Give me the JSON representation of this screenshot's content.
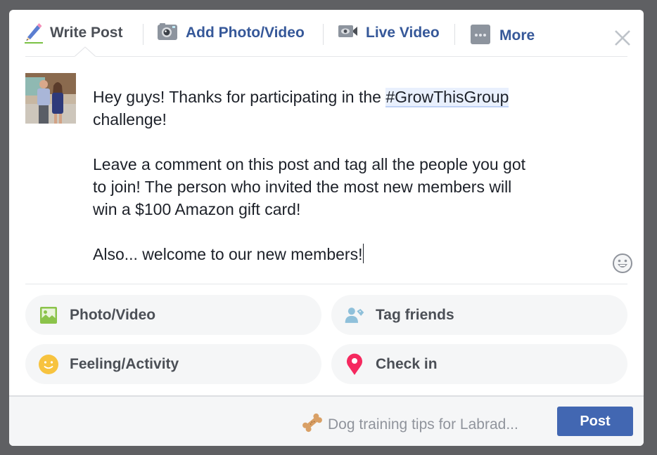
{
  "tabs": {
    "write_post": "Write Post",
    "add_photo_video": "Add Photo/Video",
    "live_video": "Live Video",
    "more": "More",
    "active": "write_post"
  },
  "composer": {
    "line1_prefix": "Hey guys! Thanks for participating in the ",
    "hashtag": "#GrowThisGroup",
    "line2": "challenge!",
    "paragraph2_line1": "Leave a comment on this post and tag all the people you got",
    "paragraph2_line2": "to join! The person who invited the most new members will",
    "paragraph2_line3": "win a $100 Amazon gift card!",
    "paragraph3": "Also... welcome to our new members!"
  },
  "actions": {
    "photo_video": "Photo/Video",
    "tag_friends": "Tag friends",
    "feeling_activity": "Feeling/Activity",
    "check_in": "Check in"
  },
  "footer": {
    "group_name": "Dog training tips for Labrad...",
    "post_button": "Post"
  },
  "colors": {
    "brand_blue": "#4267b2",
    "link_blue": "#365899",
    "photo_green": "#8bc34a",
    "feeling_yellow": "#f7c33f",
    "tag_blue": "#8fc0da",
    "checkin_pink": "#f5295f"
  }
}
